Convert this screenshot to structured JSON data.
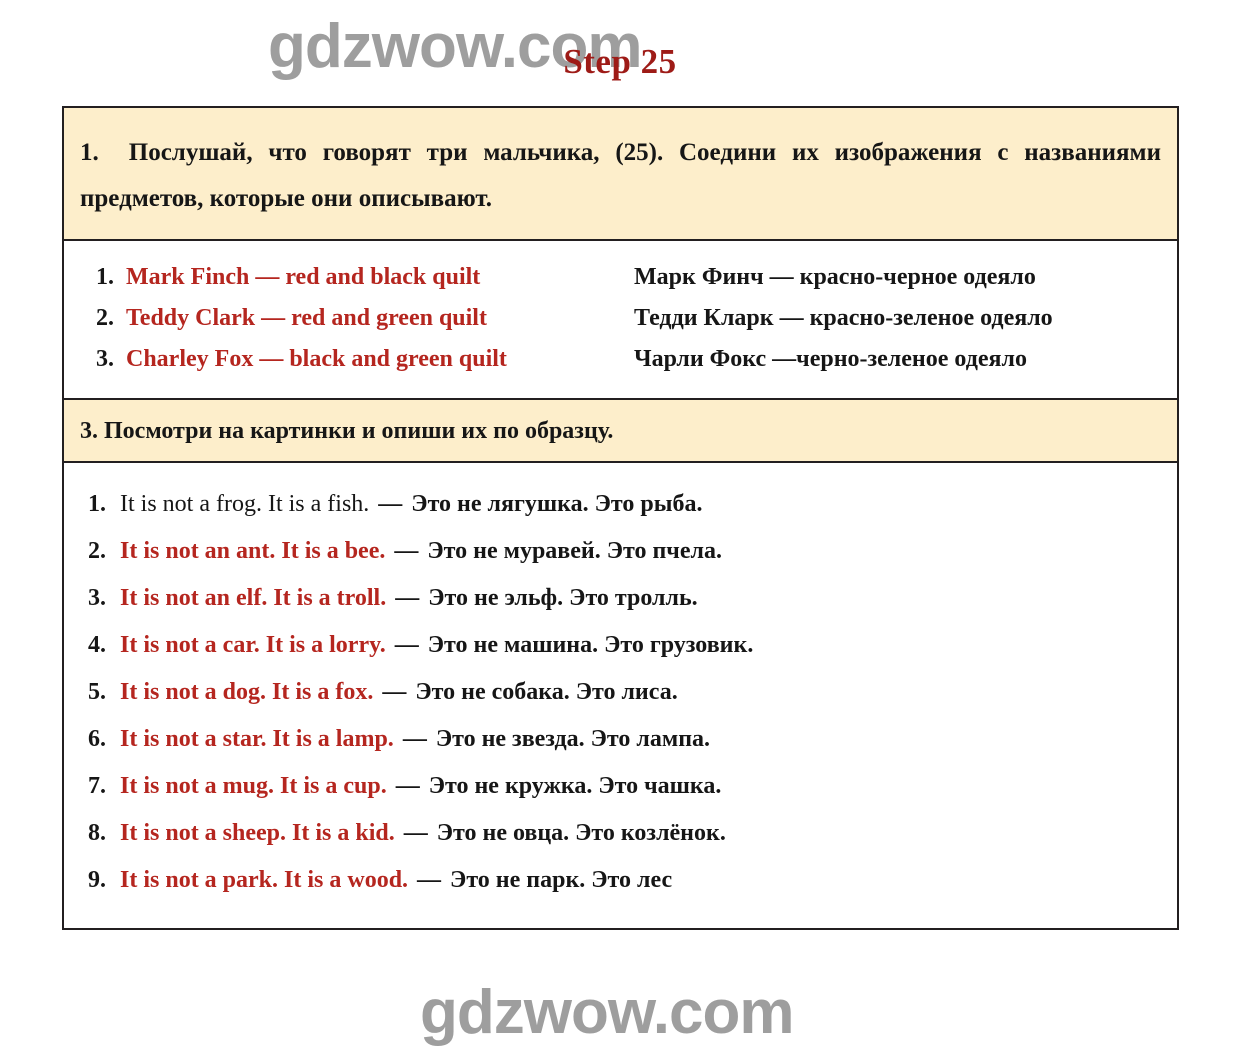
{
  "watermark": {
    "text": "gdzwow.com",
    "color": "#9e9e9e",
    "occurrences": 4
  },
  "header": {
    "title": "Step 25",
    "title_color": "#9e1b17"
  },
  "colors": {
    "answer_red": "#b5261f",
    "text_black": "#161616",
    "panel_cream": "#fdeecb",
    "border": "#231f20"
  },
  "task1": {
    "number": "1.",
    "prompt": "Послушай, что говорят три мальчика, (25). Соедини их изображения с названиями предметов, которые они описывают.",
    "matches": [
      {
        "idx": "1.",
        "en": "Mark Finch — red and black quilt",
        "ru": "Марк Финч — красно-черное одеяло"
      },
      {
        "idx": "2.",
        "en": "Teddy Clark — red and green quilt",
        "ru": "Тедди Кларк — красно-зеленое одеяло"
      },
      {
        "idx": "3.",
        "en": "Charley Fox — black and green quilt",
        "ru": "Чарли Фокс —черно-зеленое одеяло"
      }
    ]
  },
  "task3": {
    "heading": "3. Посмотри на картинки и опиши их по образцу.",
    "sentences": [
      {
        "idx": "1.",
        "en": "It is not a frog. It is a fish.",
        "dash": "—",
        "ru": "Это не лягушка. Это рыба.",
        "style": "plain"
      },
      {
        "idx": "2.",
        "en": "It is not an ant. It is a bee.",
        "dash": "—",
        "ru": "Это не муравей. Это пчела.",
        "style": "answer"
      },
      {
        "idx": "3.",
        "en": "It is not an elf. It is a troll.",
        "dash": "—",
        "ru": "Это не эльф. Это тролль.",
        "style": "answer"
      },
      {
        "idx": "4.",
        "en": "It is not a car. It is a lorry.",
        "dash": "—",
        "ru": "Это не машина. Это грузовик.",
        "style": "answer"
      },
      {
        "idx": "5.",
        "en": "It is not a dog. It is a fox.",
        "dash": "—",
        "ru": "Это не собака. Это лиса.",
        "style": "answer"
      },
      {
        "idx": "6.",
        "en": "It is not a star. It is a lamp.",
        "dash": "—",
        "ru": "Это не звезда. Это лампа.",
        "style": "answer"
      },
      {
        "idx": "7.",
        "en": "It is not a mug. It is a cup.",
        "dash": "—",
        "ru": "Это не кружка. Это чашка.",
        "style": "answer"
      },
      {
        "idx": "8.",
        "en": "It is not a sheep. It is a kid.",
        "dash": "—",
        "ru": "Это не овца. Это козлёнок.",
        "style": "answer"
      },
      {
        "idx": "9.",
        "en": "It is not a park. It is a wood.",
        "dash": "—",
        "ru": "Это не парк. Это лес",
        "style": "answer"
      }
    ]
  }
}
